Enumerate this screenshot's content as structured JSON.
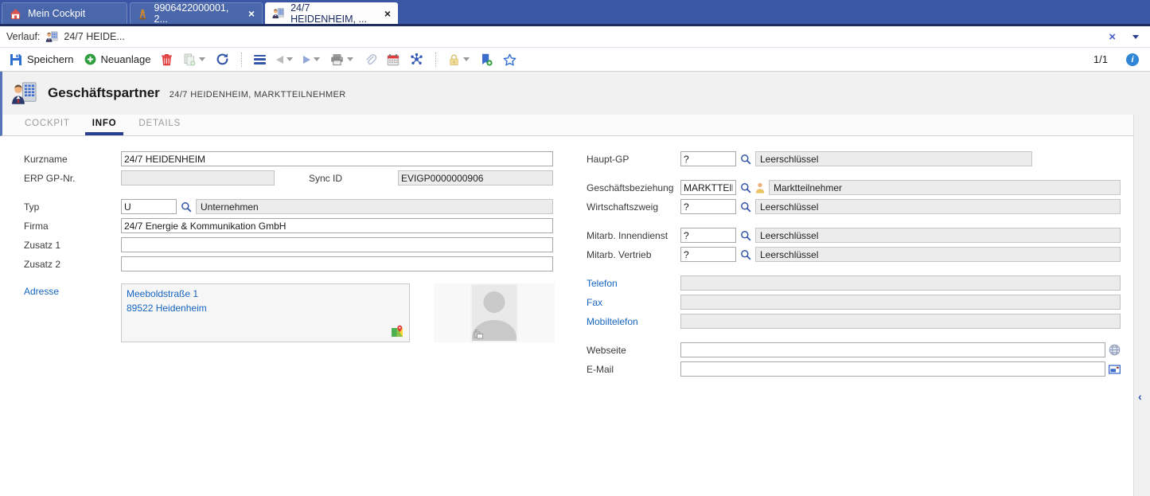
{
  "window_tabs": [
    {
      "label": "Mein Cockpit"
    },
    {
      "label": "9906422000001, 2..."
    },
    {
      "label": "24/7 HEIDENHEIM, ..."
    }
  ],
  "history_bar": {
    "label": "Verlauf:",
    "item": "24/7 HEIDE..."
  },
  "toolbar": {
    "save": "Speichern",
    "new": "Neuanlage",
    "page_indicator": "1/1"
  },
  "header": {
    "title": "Geschäftspartner",
    "subtitle": "24/7 HEIDENHEIM, MARKTTEILNEHMER"
  },
  "content_tabs": [
    {
      "label": "COCKPIT"
    },
    {
      "label": "INFO"
    },
    {
      "label": "DETAILS"
    }
  ],
  "form_left": {
    "kurzname_label": "Kurzname",
    "kurzname_value": "24/7 HEIDENHEIM",
    "erp_gp_label": "ERP GP-Nr.",
    "erp_gp_value": "",
    "sync_id_label": "Sync ID",
    "sync_id_value": "EVIGP0000000906",
    "typ_label": "Typ",
    "typ_code": "U",
    "typ_text": "Unternehmen",
    "firma_label": "Firma",
    "firma_value": "24/7 Energie & Kommunikation GmbH",
    "zusatz1_label": "Zusatz 1",
    "zusatz1_value": "",
    "zusatz2_label": "Zusatz 2",
    "zusatz2_value": "",
    "adresse_label": "Adresse",
    "adresse_line1": "Meeboldstraße 1",
    "adresse_line2": "89522 Heidenheim"
  },
  "form_right": {
    "haupt_gp_label": "Haupt-GP",
    "haupt_gp_code": "?",
    "haupt_gp_text": "Leerschlüssel",
    "geschaeftsbeziehung_label": "Geschäftsbeziehung",
    "geschaeftsbeziehung_code": "MARKTTEIL",
    "geschaeftsbeziehung_text": "Marktteilnehmer",
    "wirtschaftszweig_label": "Wirtschaftszweig",
    "wirtschaftszweig_code": "?",
    "wirtschaftszweig_text": "Leerschlüssel",
    "mitarb_innendienst_label": "Mitarb. Innendienst",
    "mitarb_innendienst_code": "?",
    "mitarb_innendienst_text": "Leerschlüssel",
    "mitarb_vertrieb_label": "Mitarb. Vertrieb",
    "mitarb_vertrieb_code": "?",
    "mitarb_vertrieb_text": "Leerschlüssel",
    "telefon_label": "Telefon",
    "telefon_value": "",
    "fax_label": "Fax",
    "fax_value": "",
    "mobiltelefon_label": "Mobiltelefon",
    "mobiltelefon_value": "",
    "webseite_label": "Webseite",
    "webseite_value": "",
    "email_label": "E-Mail",
    "email_value": ""
  },
  "icons": {
    "close": "×",
    "collapse_chevron": "‹",
    "info": "i"
  },
  "colors": {
    "tabbar_bg": "#3a57a6",
    "tab_inactive_bg": "#4a67ab",
    "tabbar_border": "#1d2c63",
    "active_tab_underline": "#27408f",
    "link_label": "#1565c0",
    "accent_blue": "#3456a8",
    "disabled_field_bg": "#ececec",
    "header_bg": "#f1f1f1"
  }
}
